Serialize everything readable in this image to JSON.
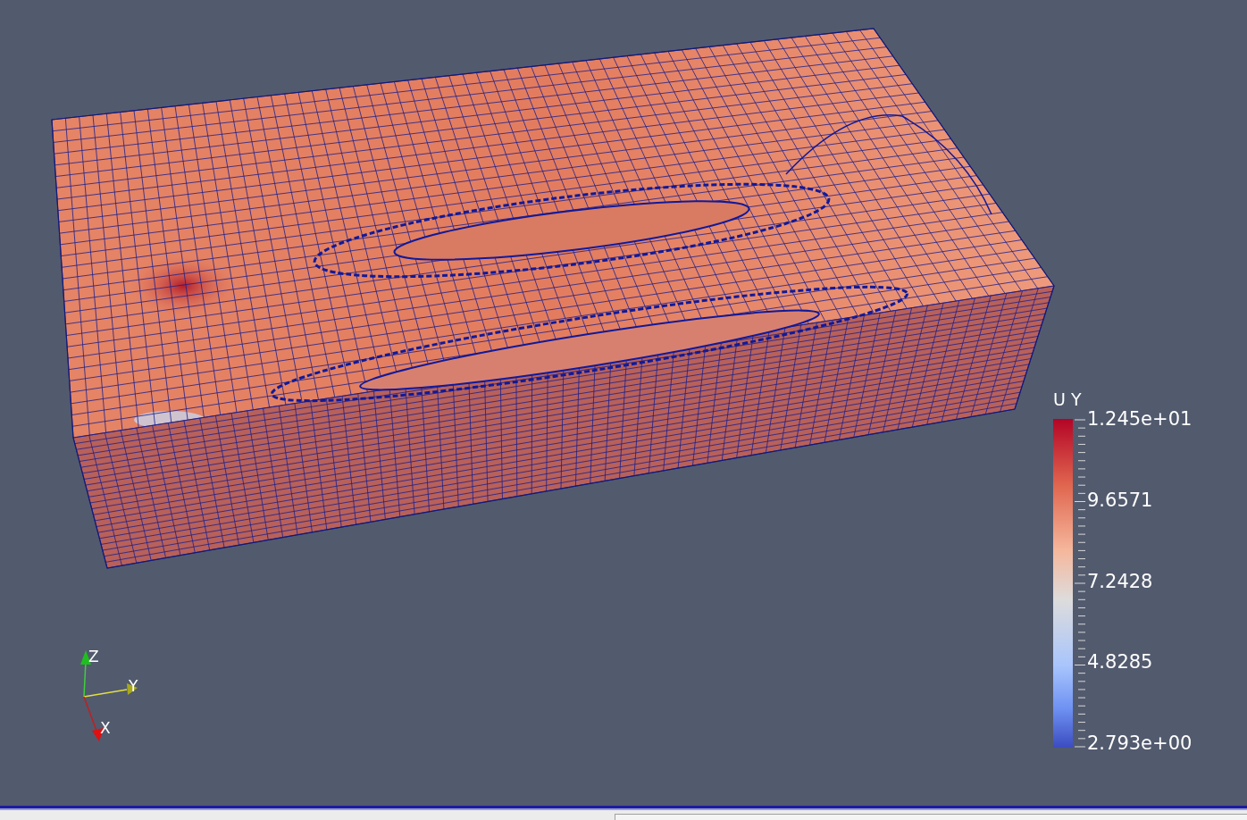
{
  "render_view": {
    "legend": {
      "title": "U Y",
      "labels": [
        "1.245e+01",
        "9.6571",
        "7.2428",
        "4.8285",
        "2.793e+00"
      ]
    },
    "axes": {
      "x": "X",
      "y": "Y",
      "z": "Z"
    }
  }
}
